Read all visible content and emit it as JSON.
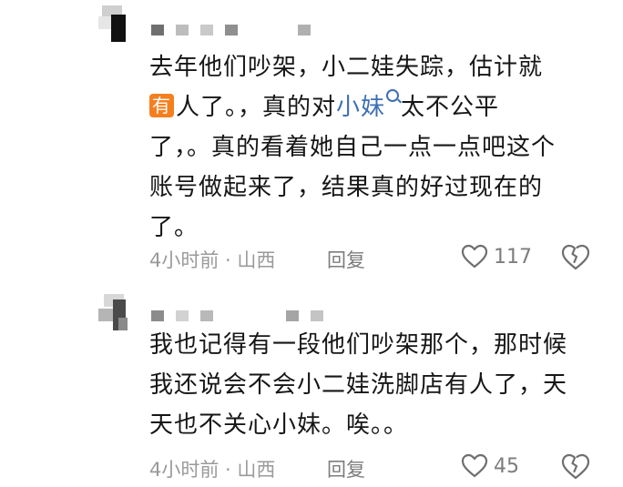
{
  "comments": [
    {
      "lines": [
        [
          "去年他们吵架，小二娃失踪，估计就"
        ],
        [
          "人了。，真的对",
          "小妹",
          "太不公平"
        ],
        [
          "了，。真的看着她自己一点一点吧这个"
        ],
        [
          "账号做起来了，结果真的好过现在的"
        ],
        [
          "了。"
        ]
      ],
      "badge": "有",
      "time_location": "4小时前 · 山西",
      "reply_label": "回复",
      "like_count": "117"
    },
    {
      "lines": [
        [
          "我也记得有一段他们吵架那个，那时候"
        ],
        [
          "我还说会不会小二娃洗脚店有人了，天"
        ],
        [
          "天也不关心小妹。唉。。"
        ]
      ],
      "time_location": "4小时前 · 山西",
      "reply_label": "回复",
      "like_count": "45"
    }
  ],
  "colors": {
    "text": "#161616",
    "meta": "#9a9a9a",
    "link": "#3d6fb3",
    "badge": "#f57f1e"
  },
  "icons": [
    "heart-icon",
    "broken-heart-icon",
    "search-icon"
  ]
}
